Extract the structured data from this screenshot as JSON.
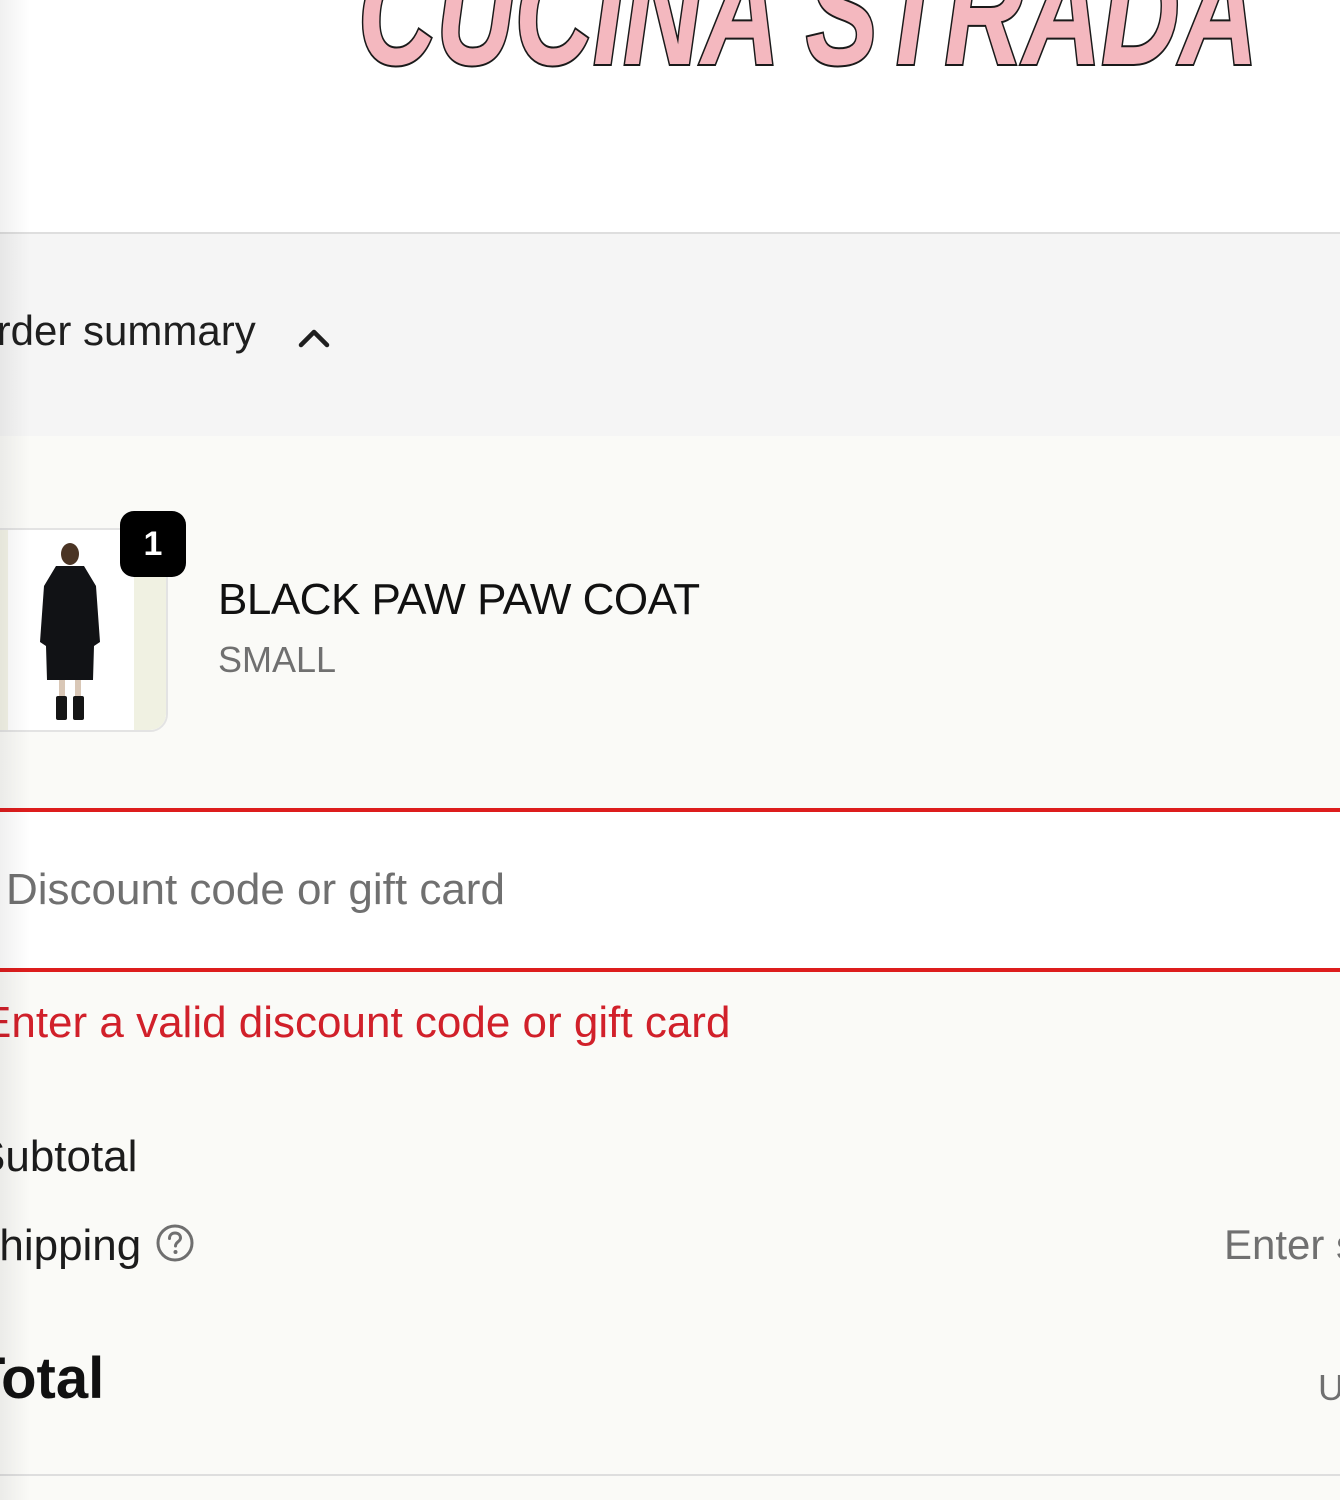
{
  "brand": {
    "logo_text": "CUCINA STRADA",
    "logo_fill": "#f4b8bf",
    "logo_outline": "#1a1a1a"
  },
  "summary_toggle": {
    "label": "Order summary",
    "icon": "chevron-up-icon"
  },
  "line_item": {
    "quantity": "1",
    "name": "BLACK PAW PAW COAT",
    "variant": "SMALL",
    "image_alt": "black coat product photo"
  },
  "discount": {
    "value": "",
    "placeholder": "Discount code or gift card",
    "error": "Enter a valid discount code or gift card",
    "error_color": "#d1202a"
  },
  "totals": {
    "subtotal_label": "Subtotal",
    "shipping_label": "Shipping",
    "shipping_help_icon": "question-circle-icon",
    "shipping_value": "Enter shipping address",
    "total_label": "Total",
    "total_currency": "USD"
  }
}
